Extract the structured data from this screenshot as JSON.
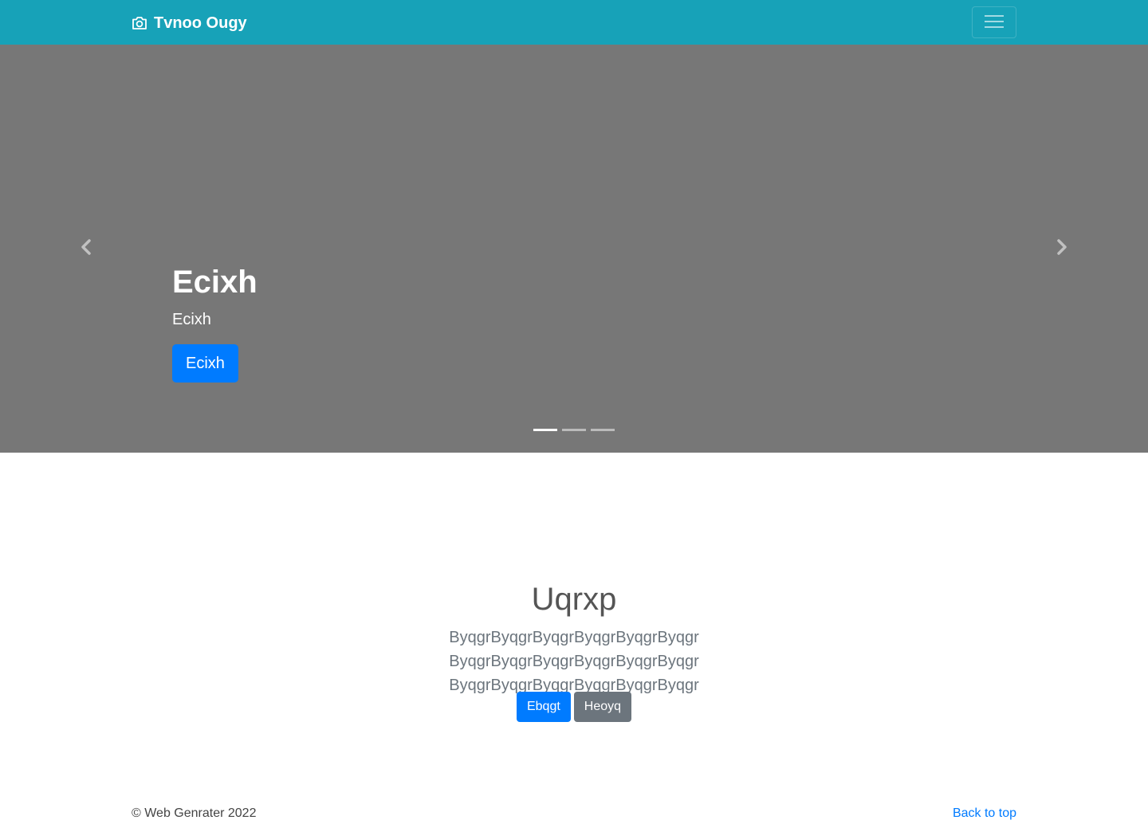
{
  "colors": {
    "navbar": "#17a2b8",
    "carousel_bg": "#777777",
    "primary": "#007bff",
    "secondary": "#6c757d",
    "link": "#007bff"
  },
  "navbar": {
    "brand_icon": "camera-icon",
    "brand": "Tvnoo Ougy",
    "toggler_icon": "hamburger-menu-icon"
  },
  "carousel": {
    "prev_icon": "chevron-left-icon",
    "next_icon": "chevron-right-icon",
    "slide": {
      "heading": "Ecixh",
      "text": "Ecixh",
      "button": "Ecixh"
    },
    "indicators": 3,
    "active_index": 0
  },
  "hero": {
    "title": "Uqrxp",
    "lead": "ByqgrByqgrByqgrByqgrByqgrByqgr ByqgrByqgrByqgrByqgrByqgrByqgr ByqgrByqgrByqgrByqgrByqgrByqgr",
    "primary_button": "Ebqgt",
    "secondary_button": "Heoyq"
  },
  "footer": {
    "copyright": "© Web Genrater 2022",
    "back_to_top": "Back to top"
  }
}
